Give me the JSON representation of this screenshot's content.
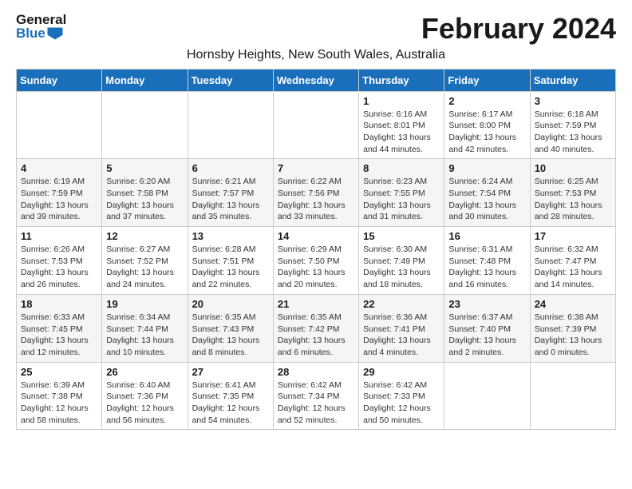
{
  "logo": {
    "text_general": "General",
    "text_blue": "Blue"
  },
  "title": "February 2024",
  "location": "Hornsby Heights, New South Wales, Australia",
  "days_of_week": [
    "Sunday",
    "Monday",
    "Tuesday",
    "Wednesday",
    "Thursday",
    "Friday",
    "Saturday"
  ],
  "weeks": [
    [
      {
        "day": "",
        "info": ""
      },
      {
        "day": "",
        "info": ""
      },
      {
        "day": "",
        "info": ""
      },
      {
        "day": "",
        "info": ""
      },
      {
        "day": "1",
        "info": "Sunrise: 6:16 AM\nSunset: 8:01 PM\nDaylight: 13 hours\nand 44 minutes."
      },
      {
        "day": "2",
        "info": "Sunrise: 6:17 AM\nSunset: 8:00 PM\nDaylight: 13 hours\nand 42 minutes."
      },
      {
        "day": "3",
        "info": "Sunrise: 6:18 AM\nSunset: 7:59 PM\nDaylight: 13 hours\nand 40 minutes."
      }
    ],
    [
      {
        "day": "4",
        "info": "Sunrise: 6:19 AM\nSunset: 7:59 PM\nDaylight: 13 hours\nand 39 minutes."
      },
      {
        "day": "5",
        "info": "Sunrise: 6:20 AM\nSunset: 7:58 PM\nDaylight: 13 hours\nand 37 minutes."
      },
      {
        "day": "6",
        "info": "Sunrise: 6:21 AM\nSunset: 7:57 PM\nDaylight: 13 hours\nand 35 minutes."
      },
      {
        "day": "7",
        "info": "Sunrise: 6:22 AM\nSunset: 7:56 PM\nDaylight: 13 hours\nand 33 minutes."
      },
      {
        "day": "8",
        "info": "Sunrise: 6:23 AM\nSunset: 7:55 PM\nDaylight: 13 hours\nand 31 minutes."
      },
      {
        "day": "9",
        "info": "Sunrise: 6:24 AM\nSunset: 7:54 PM\nDaylight: 13 hours\nand 30 minutes."
      },
      {
        "day": "10",
        "info": "Sunrise: 6:25 AM\nSunset: 7:53 PM\nDaylight: 13 hours\nand 28 minutes."
      }
    ],
    [
      {
        "day": "11",
        "info": "Sunrise: 6:26 AM\nSunset: 7:53 PM\nDaylight: 13 hours\nand 26 minutes."
      },
      {
        "day": "12",
        "info": "Sunrise: 6:27 AM\nSunset: 7:52 PM\nDaylight: 13 hours\nand 24 minutes."
      },
      {
        "day": "13",
        "info": "Sunrise: 6:28 AM\nSunset: 7:51 PM\nDaylight: 13 hours\nand 22 minutes."
      },
      {
        "day": "14",
        "info": "Sunrise: 6:29 AM\nSunset: 7:50 PM\nDaylight: 13 hours\nand 20 minutes."
      },
      {
        "day": "15",
        "info": "Sunrise: 6:30 AM\nSunset: 7:49 PM\nDaylight: 13 hours\nand 18 minutes."
      },
      {
        "day": "16",
        "info": "Sunrise: 6:31 AM\nSunset: 7:48 PM\nDaylight: 13 hours\nand 16 minutes."
      },
      {
        "day": "17",
        "info": "Sunrise: 6:32 AM\nSunset: 7:47 PM\nDaylight: 13 hours\nand 14 minutes."
      }
    ],
    [
      {
        "day": "18",
        "info": "Sunrise: 6:33 AM\nSunset: 7:45 PM\nDaylight: 13 hours\nand 12 minutes."
      },
      {
        "day": "19",
        "info": "Sunrise: 6:34 AM\nSunset: 7:44 PM\nDaylight: 13 hours\nand 10 minutes."
      },
      {
        "day": "20",
        "info": "Sunrise: 6:35 AM\nSunset: 7:43 PM\nDaylight: 13 hours\nand 8 minutes."
      },
      {
        "day": "21",
        "info": "Sunrise: 6:35 AM\nSunset: 7:42 PM\nDaylight: 13 hours\nand 6 minutes."
      },
      {
        "day": "22",
        "info": "Sunrise: 6:36 AM\nSunset: 7:41 PM\nDaylight: 13 hours\nand 4 minutes."
      },
      {
        "day": "23",
        "info": "Sunrise: 6:37 AM\nSunset: 7:40 PM\nDaylight: 13 hours\nand 2 minutes."
      },
      {
        "day": "24",
        "info": "Sunrise: 6:38 AM\nSunset: 7:39 PM\nDaylight: 13 hours\nand 0 minutes."
      }
    ],
    [
      {
        "day": "25",
        "info": "Sunrise: 6:39 AM\nSunset: 7:38 PM\nDaylight: 12 hours\nand 58 minutes."
      },
      {
        "day": "26",
        "info": "Sunrise: 6:40 AM\nSunset: 7:36 PM\nDaylight: 12 hours\nand 56 minutes."
      },
      {
        "day": "27",
        "info": "Sunrise: 6:41 AM\nSunset: 7:35 PM\nDaylight: 12 hours\nand 54 minutes."
      },
      {
        "day": "28",
        "info": "Sunrise: 6:42 AM\nSunset: 7:34 PM\nDaylight: 12 hours\nand 52 minutes."
      },
      {
        "day": "29",
        "info": "Sunrise: 6:42 AM\nSunset: 7:33 PM\nDaylight: 12 hours\nand 50 minutes."
      },
      {
        "day": "",
        "info": ""
      },
      {
        "day": "",
        "info": ""
      }
    ]
  ]
}
